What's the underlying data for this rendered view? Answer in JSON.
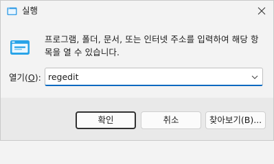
{
  "window": {
    "title": "실행",
    "close_icon": "close-icon"
  },
  "content": {
    "description": "프로그램, 폴더, 문서, 또는 인터넷 주소를 입력하여 해당 항목을 열 수 있습니다.",
    "open_label_prefix": "열기(",
    "open_label_accel": "O",
    "open_label_suffix": "):",
    "open_value": "regedit"
  },
  "buttons": {
    "ok": "확인",
    "cancel": "취소",
    "browse": "찾아보기(B)..."
  },
  "colors": {
    "accent": "#0067c0",
    "dialog_bg": "#f3f3f3",
    "footer_bg": "#e9e9e9"
  }
}
